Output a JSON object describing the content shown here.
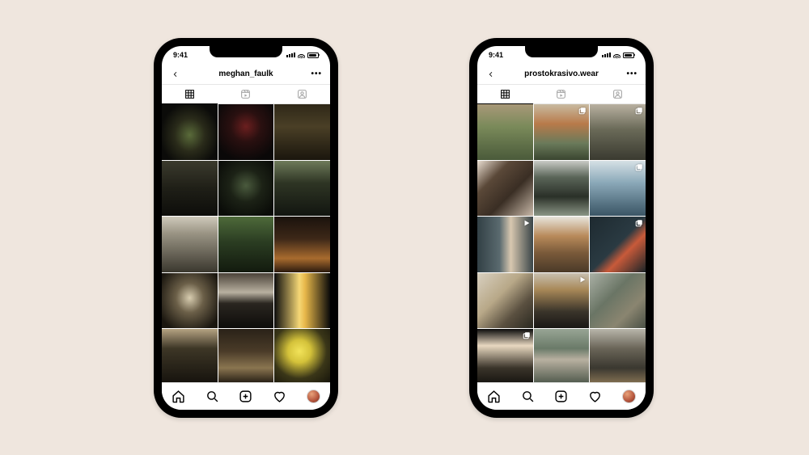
{
  "status": {
    "time": "9:41"
  },
  "phones": [
    {
      "username": "meghan_faulk",
      "grid_style": "dark_moody",
      "cells": [
        {
          "bg": "radial-gradient(ellipse at 50% 55%, #5a6b3a 0%, #2a2b1a 38%, #0b0b09 75%)",
          "indicator": null
        },
        {
          "bg": "radial-gradient(circle at 50% 40%, #6b1f1f 0%, #2a1010 35%, #0a0808 80%)",
          "indicator": null
        },
        {
          "bg": "linear-gradient(180deg,#2f2818 0%, #4a3f26 40%, #1a160d 100%)",
          "indicator": null
        },
        {
          "bg": "linear-gradient(180deg,#3b3a2d 0%, #1f1f17 50%, #0d0d0a 100%)",
          "indicator": null
        },
        {
          "bg": "radial-gradient(circle at 50% 45%, #4a5a3d 0%, #1c2216 40%, #0a0c08 85%)",
          "indicator": null
        },
        {
          "bg": "linear-gradient(180deg,#6e7a5a 0%, #2e3524 40%, #121510 100%)",
          "indicator": null
        },
        {
          "bg": "linear-gradient(180deg,#cfcabb 0%, #9a9484 30%, #3a372e 100%)",
          "indicator": null
        },
        {
          "bg": "linear-gradient(180deg,#4e6a3a 0%, #2b3d22 45%, #121a0e 100%)",
          "indicator": null
        },
        {
          "bg": "linear-gradient(180deg,#1a120c 0%, #3d2818 40%, #a86b2e 75%, #2a1a0e 100%)",
          "indicator": null
        },
        {
          "bg": "radial-gradient(ellipse at 50% 45%, #d8cdb0 0%, #6b5f48 35%, #1a160f 85%)",
          "indicator": null
        },
        {
          "bg": "linear-gradient(180deg,#4a4238 0%, #b8b0a0 35%, #2a2620 55%, #0d0c0a 100%)",
          "indicator": null
        },
        {
          "bg": "linear-gradient(90deg,#0c0c0c 0%, #f5d776 45%, #e8b84a 55%, #0a0a0a 100%)",
          "indicator": null
        },
        {
          "bg": "linear-gradient(180deg,#b5a382 0%, #3d3626 35%, #14110c 100%)",
          "indicator": null
        },
        {
          "bg": "linear-gradient(180deg,#2a2218 0%, #4a3b28 40%, #8a7550 70%, #1a140d 100%)",
          "indicator": null
        },
        {
          "bg": "radial-gradient(circle at 45% 40%, #f2e35a 0%, #d4c23a 25%, #3a3618 60%, #14120a 100%)",
          "indicator": null
        }
      ]
    },
    {
      "username": "prostokrasivo.wear",
      "grid_style": "muted_editorial",
      "cells": [
        {
          "bg": "linear-gradient(180deg,#a89878 0%, #7a8a5a 40%, #4a5a3a 100%)",
          "indicator": null
        },
        {
          "bg": "linear-gradient(180deg,#c8baa0 0%, #b87a4a 35%, #6a7a5a 70%, #3a4530 100%)",
          "indicator": "stack"
        },
        {
          "bg": "linear-gradient(180deg,#b8b0a0 0%, #6a6a58 45%, #3a3a30 100%)",
          "indicator": "stack"
        },
        {
          "bg": "linear-gradient(135deg,#e8ddd0 0%, #5a4838 30%, #3a2e24 60%, #c8b8a8 100%)",
          "indicator": null
        },
        {
          "bg": "linear-gradient(180deg,#c8cac5 0%, #5a6558 30%, #2a3028 65%, #8a9585 100%)",
          "indicator": null
        },
        {
          "bg": "linear-gradient(180deg,#d5e0e5 0%, #8aa8b8 40%, #3a5565 100%)",
          "indicator": "stack"
        },
        {
          "bg": "linear-gradient(90deg,#324045 0%, #5a6a6f 40%, #d8c8b0 60%, #3a4548 100%)",
          "indicator": "play"
        },
        {
          "bg": "linear-gradient(180deg,#e8e5dd 0%, #b88a5a 35%, #7a5a3a 65%, #4a3a28 100%)",
          "indicator": null
        },
        {
          "bg": "linear-gradient(135deg,#1e2a30 0%, #2a3a42 50%, #c85a3a 65%, #1a2428 100%)",
          "indicator": "stack"
        },
        {
          "bg": "linear-gradient(135deg,#d8d0c0 0%, #b8a888 40%, #5a5040 70%, #2a2820 100%)",
          "indicator": null
        },
        {
          "bg": "linear-gradient(180deg,#c8c0b0 0%, #a88858 30%, #3a342a 70%, #1a1815 100%)",
          "indicator": "play"
        },
        {
          "bg": "linear-gradient(135deg,#aab0a5 0%, #6a7565 40%, #8a8570 70%, #4a5045 100%)",
          "indicator": null
        },
        {
          "bg": "linear-gradient(180deg,#0a0a0a 0%, #e8d8c0 30%, #3a342a 70%, #15130f 100%)",
          "indicator": "stack"
        },
        {
          "bg": "linear-gradient(180deg,#98a595 0%, #6a7a68 35%, #b8b0a0 55%, #4a5548 100%)",
          "indicator": null
        },
        {
          "bg": "linear-gradient(180deg,#b8b5aa 0%, #6a6558 35%, #3a3830 70%, #8a7555 100%)",
          "indicator": null
        }
      ]
    }
  ],
  "icons": {
    "back": "chevron-left-icon",
    "more": "more-icon",
    "tab_grid": "grid-icon",
    "tab_reels": "reels-icon",
    "tab_tagged": "tagged-icon",
    "nav_home": "home-icon",
    "nav_search": "search-icon",
    "nav_new": "plus-square-icon",
    "nav_activity": "heart-icon",
    "nav_profile": "profile-avatar"
  }
}
